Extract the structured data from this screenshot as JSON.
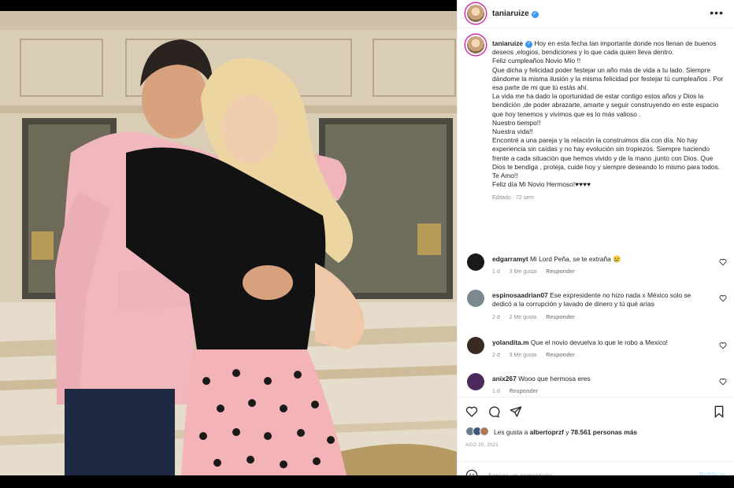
{
  "post": {
    "username": "taniaruize",
    "more_icon": "more-horizontal-icon"
  },
  "caption": {
    "username": "taniaruize",
    "lines": [
      "Hoy en esta fecha tan importante donde nos llenan de buenos deseos ,elogios, bendiciones y lo que cada quien lleva dentro.",
      "Feliz cumpleaños Novio Mío !!",
      "Que dicha y felicidad poder festejar un año más de vida a tu lado. Siempre dándome la misma ilusión y la misma felicidad por festejar tú cumpleaños . Por esa parte de mi que tú estás ahí.",
      "La vida me ha dado la oportunidad de estar contigo estos años y Dios la bendición ,de poder abrazarte, amarte y seguir construyendo en este espacio que hoy tenemos y vivimos que es lo más valioso .",
      "Nuestro tiempo!!",
      "Nuestra vida!!",
      "Encontré a una pareja y la relación la construimos día con día. No hay experiencia sin caídas y no hay evolución sin tropiezos. Siempre haciendo frente a cada situación que hemos vivido y de la mano ,junto con Dios. Que Dios te bendiga , proteja, cuide hoy y siempre deseando lo mismo para todos. Te Amo!!",
      "Feliz día Mi Novio Hermoso!♥♥♥♥"
    ],
    "meta": "Editado · 72 sem"
  },
  "comments": [
    {
      "username": "edgarramyt",
      "text": "Mi Lord Peña, se te extraña 😢",
      "time": "1 d",
      "likes": "3 Me gusta",
      "reply": "Responder",
      "avatar_color": "#1a1a1a"
    },
    {
      "username": "espinosaadrian07",
      "text": "Ese expresidente no hizo nada x México solo se dedicó a la corrupción y lavado de dinero y tú qué arías",
      "time": "2 d",
      "likes": "2 Me gusta",
      "reply": "Responder",
      "avatar_color": "#7a8a8e"
    },
    {
      "username": "yolandita.m",
      "text": "Que el novio devuelva lo que le robo a Mexico!",
      "time": "2 d",
      "likes": "9 Me gusta",
      "reply": "Responder",
      "avatar_color": "#3a2a22"
    },
    {
      "username": "anix267",
      "text": "Wooo que hermosa eres",
      "time": "1 d",
      "likes": "",
      "reply": "Responder",
      "avatar_color": "#4b2a5e"
    }
  ],
  "likes": {
    "prefix": "Les gusta a",
    "user": "albertoprzf",
    "connector": "y",
    "count": "78.561 personas más"
  },
  "date": "AGO 20, 2021",
  "add_comment": {
    "placeholder": "Agrega un comentario...",
    "publish": "Publicar"
  },
  "colors": {
    "verified": "#3897f0",
    "publish_disabled": "#b2dffc",
    "muted": "#8e8e8e"
  }
}
